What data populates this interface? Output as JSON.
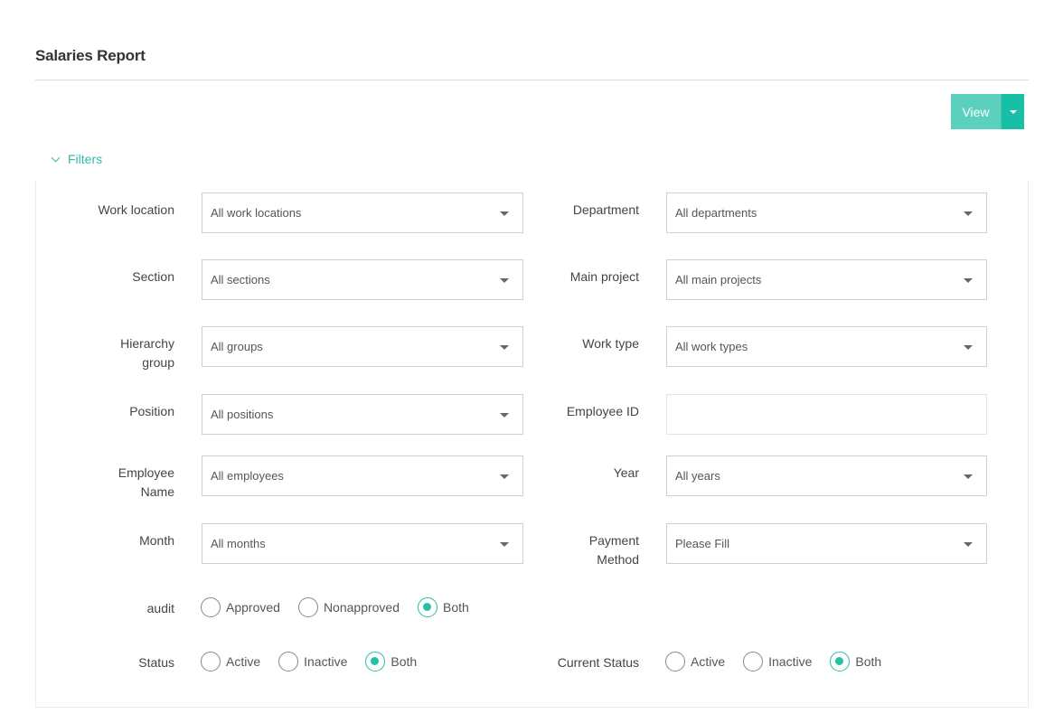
{
  "page": {
    "title": "Salaries Report"
  },
  "toolbar": {
    "view_label": "View"
  },
  "filters": {
    "toggle_label": "Filters",
    "work_location": {
      "label": "Work location",
      "value": "All work locations"
    },
    "department": {
      "label": "Department",
      "value": "All departments"
    },
    "section": {
      "label": "Section",
      "value": "All sections"
    },
    "main_project": {
      "label": "Main project",
      "value": "All main projects"
    },
    "hierarchy_group": {
      "label_line1": "Hierarchy",
      "label_line2": "group",
      "value": "All groups"
    },
    "work_type": {
      "label": "Work type",
      "value": "All work types"
    },
    "position": {
      "label": "Position",
      "value": "All positions"
    },
    "employee_id": {
      "label": "Employee ID",
      "value": ""
    },
    "employee_name": {
      "label_line1": "Employee",
      "label_line2": "Name",
      "value": "All employees"
    },
    "year": {
      "label": "Year",
      "value": "All years"
    },
    "month": {
      "label": "Month",
      "value": "All months"
    },
    "payment_method": {
      "label_line1": "Payment",
      "label_line2": "Method",
      "value": "Please Fill"
    },
    "audit": {
      "label": "audit",
      "options": [
        "Approved",
        "Nonapproved",
        "Both"
      ],
      "selected": "Both"
    },
    "status": {
      "label": "Status",
      "options": [
        "Active",
        "Inactive",
        "Both"
      ],
      "selected": "Both"
    },
    "current_status": {
      "label": "Current Status",
      "options": [
        "Active",
        "Inactive",
        "Both"
      ],
      "selected": "Both"
    }
  },
  "colors": {
    "accent": "#26bfa7",
    "view_button": "#5ad0bd",
    "view_caret_button": "#17bfa6",
    "filters_link": "#35b9a8"
  }
}
